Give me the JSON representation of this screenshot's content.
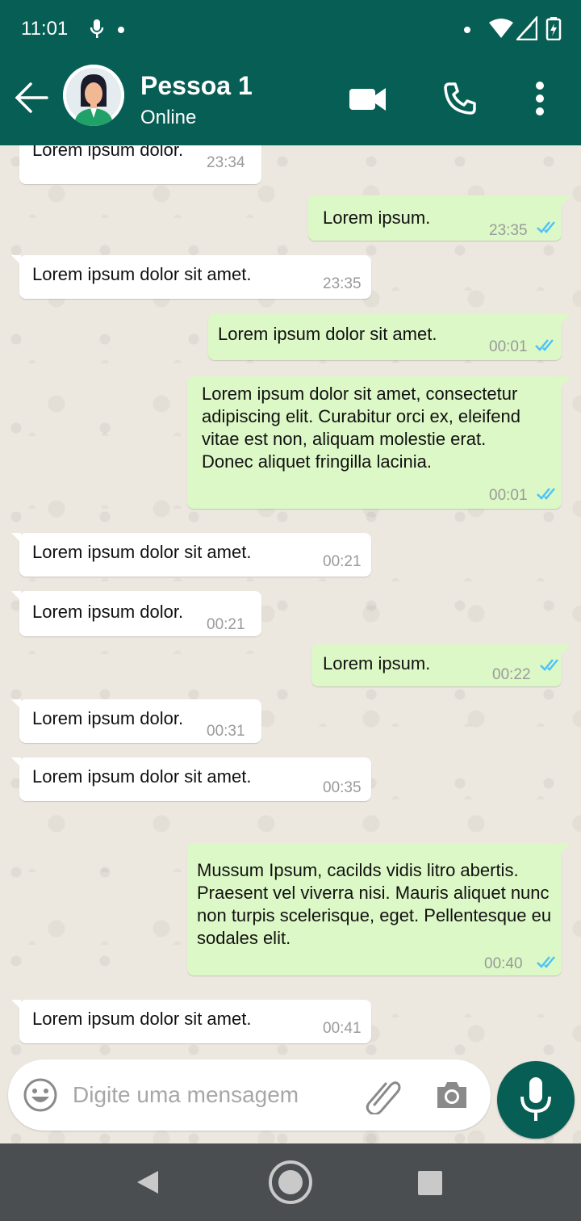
{
  "status_bar": {
    "time": "11:01",
    "icons": [
      "mic-icon",
      "dot-icon",
      "wifi-icon",
      "signal-icon",
      "battery-charging-icon"
    ]
  },
  "header": {
    "contact_name": "Pessoa 1",
    "contact_status": "Online",
    "icons": [
      "back-arrow-icon",
      "avatar",
      "video-call-icon",
      "phone-icon",
      "more-vert-icon"
    ],
    "bg_color": "#075e54"
  },
  "messages": [
    {
      "dir": "in",
      "text": "Lorem ipsum dolor.",
      "time": "23:34"
    },
    {
      "dir": "out",
      "text": "Lorem ipsum.",
      "time": "23:35",
      "read": true
    },
    {
      "dir": "in",
      "text": "Lorem ipsum dolor sit amet.",
      "time": "23:35"
    },
    {
      "dir": "out",
      "text": "Lorem ipsum dolor sit amet.",
      "time": "00:01",
      "read": true
    },
    {
      "dir": "out",
      "text": "Lorem ipsum dolor sit amet, consectetur adipiscing elit. Curabitur orci ex, eleifend vitae est non, aliquam molestie erat. Donec aliquet fringilla lacinia.",
      "time": "00:01",
      "read": true
    },
    {
      "dir": "in",
      "text": "Lorem ipsum dolor sit amet.",
      "time": "00:21"
    },
    {
      "dir": "in",
      "text": "Lorem ipsum dolor.",
      "time": "00:21"
    },
    {
      "dir": "out",
      "text": "Lorem ipsum.",
      "time": "00:22",
      "read": true
    },
    {
      "dir": "in",
      "text": "Lorem ipsum dolor.",
      "time": "00:31"
    },
    {
      "dir": "in",
      "text": "Lorem ipsum dolor sit amet.",
      "time": "00:35"
    },
    {
      "dir": "out",
      "text": "Mussum Ipsum, cacilds vidis litro abertis. Praesent vel viverra nisi. Mauris aliquet nunc non turpis scelerisque, eget. Pellentesque eu sodales elit.",
      "time": "00:40",
      "read": true
    },
    {
      "dir": "in",
      "text": "Lorem ipsum dolor sit amet.",
      "time": "00:41"
    }
  ],
  "composer": {
    "placeholder": "Digite uma mensagem",
    "value": "",
    "icons": [
      "emoji-icon",
      "paperclip-icon",
      "camera-icon",
      "mic-icon"
    ]
  },
  "nav_bar": {
    "icons": [
      "nav-back-icon",
      "nav-home-icon",
      "nav-recents-icon"
    ]
  },
  "colors": {
    "primary": "#075e54",
    "outgoing_bubble": "#dcf8c6",
    "incoming_bubble": "#ffffff",
    "read_tick": "#4fc3f7"
  }
}
